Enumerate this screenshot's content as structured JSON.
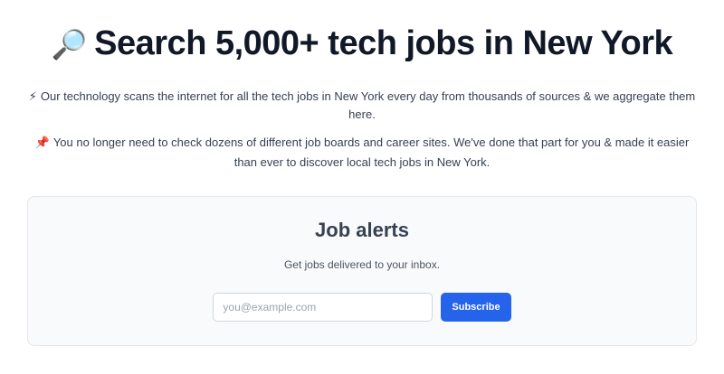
{
  "hero": {
    "emoji": "🔎",
    "title": "Search 5,000+ tech jobs in New York",
    "p1_emoji": "⚡",
    "p1_text": "Our technology scans the internet for all the tech jobs in New York every day from thousands of sources & we aggregate them here.",
    "p2_emoji": "📌",
    "p2_text": "You no longer need to check dozens of different job boards and career sites. We've done that part for you & made it easier than ever to discover local tech jobs in New York."
  },
  "alerts": {
    "heading": "Job alerts",
    "subtitle": "Get jobs delivered to your inbox.",
    "email_placeholder": "you@example.com",
    "email_value": "",
    "subscribe_label": "Subscribe"
  },
  "colors": {
    "accent": "#2563eb",
    "card_background": "#f9fafb",
    "card_border": "#e5e7eb",
    "heading": "#111827"
  }
}
